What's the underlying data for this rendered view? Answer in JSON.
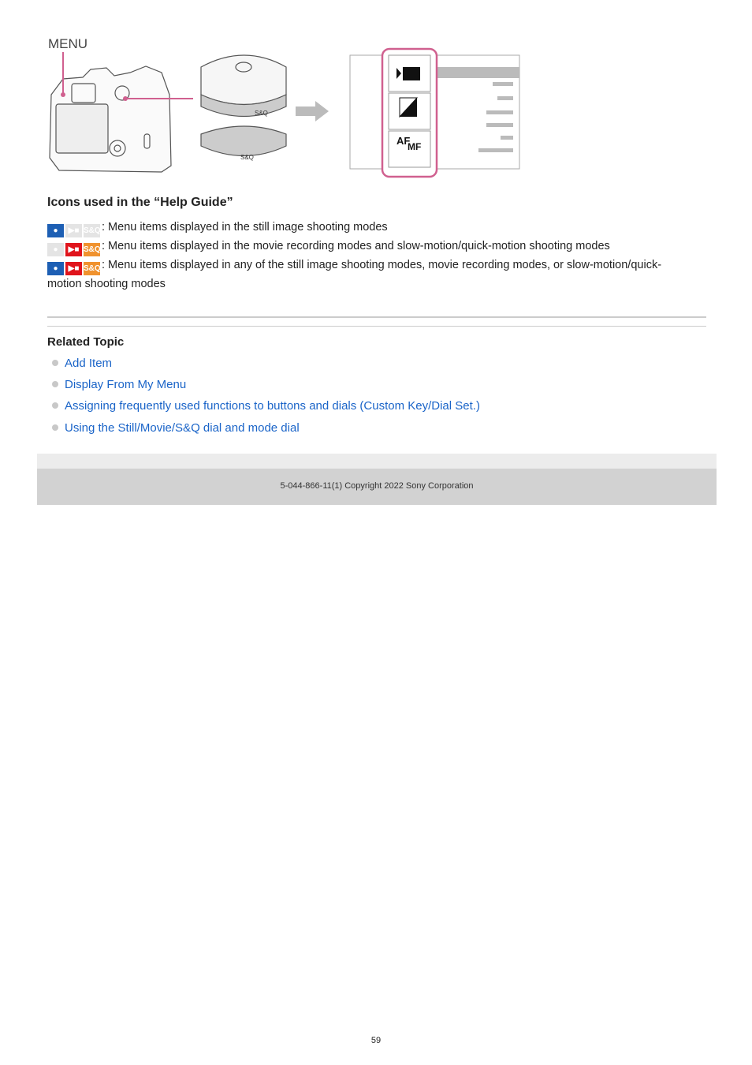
{
  "illustration": {
    "menu_label": "MENU",
    "dial_labels": [
      "S&Q",
      "S&Q"
    ],
    "menu_icon_af": "AF",
    "menu_icon_mf": "MF",
    "highlight_color": "#d0608f"
  },
  "icons_section": {
    "title": "Icons used in the “Help Guide”",
    "rows": [
      {
        "icons": [
          {
            "name": "still",
            "active": true,
            "color": "#1d5fb4"
          },
          {
            "name": "movie",
            "active": false
          },
          {
            "name": "S&Q",
            "active": false
          }
        ],
        "text": ": Menu items displayed in the still image shooting modes"
      },
      {
        "icons": [
          {
            "name": "still",
            "active": false
          },
          {
            "name": "movie",
            "active": true,
            "color": "#e0141c"
          },
          {
            "name": "S&Q",
            "active": true,
            "color": "#f0922e"
          }
        ],
        "text": ": Menu items displayed in the movie recording modes and slow-motion/quick-motion shooting modes"
      },
      {
        "icons": [
          {
            "name": "still",
            "active": true,
            "color": "#1d5fb4"
          },
          {
            "name": "movie",
            "active": true,
            "color": "#e0141c"
          },
          {
            "name": "S&Q",
            "active": true,
            "color": "#f0922e"
          }
        ],
        "text": ": Menu items displayed in any of the still image shooting modes, movie recording modes, or slow-motion/quick-motion shooting modes"
      }
    ],
    "sq_label": "S&Q"
  },
  "related": {
    "title": "Related Topic",
    "links": [
      "Add Item",
      "Display From My Menu",
      "Assigning frequently used functions to buttons and dials (Custom Key/Dial Set.)",
      "Using the Still/Movie/S&Q dial and mode dial"
    ]
  },
  "footer": {
    "copyright": "5-044-866-11(1) Copyright 2022 Sony Corporation"
  },
  "page_number": "59"
}
